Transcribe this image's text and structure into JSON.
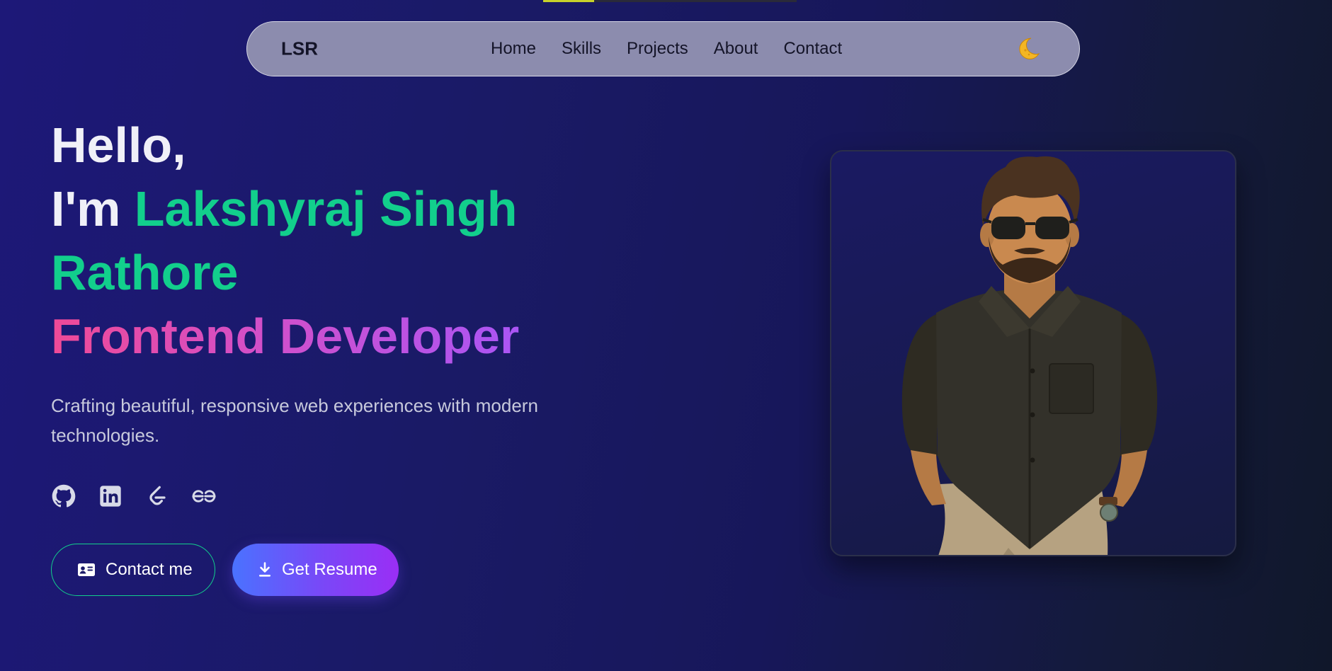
{
  "scroll_progress": {
    "value": 0.2,
    "color": "#c7d22a"
  },
  "navbar": {
    "logo": "LSR",
    "links": [
      "Home",
      "Skills",
      "Projects",
      "About",
      "Contact"
    ],
    "theme_toggle_icon": "moon-icon"
  },
  "hero": {
    "greeting": "Hello,",
    "im": "I'm",
    "name_part1": "Lakshyraj Singh",
    "name_part2": "Rathore",
    "role": "Frontend Developer",
    "subtitle": "Crafting beautiful, responsive web experiences with modern technologies.",
    "socials": [
      {
        "name": "GitHub",
        "icon": "github-icon"
      },
      {
        "name": "LinkedIn",
        "icon": "linkedin-icon"
      },
      {
        "name": "LeetCode",
        "icon": "leetcode-icon"
      },
      {
        "name": "GeeksforGeeks",
        "icon": "geeksforgeeks-icon"
      }
    ],
    "contact_button": "Contact me",
    "resume_button": "Get Resume"
  },
  "colors": {
    "accent_green": "#12cf8c",
    "gradient_pink": "#ef4a97",
    "gradient_purple": "#aa55f5",
    "button_blue": "#4a72ff"
  },
  "portrait": {
    "icon": "cartoon-avatar-illustration"
  }
}
